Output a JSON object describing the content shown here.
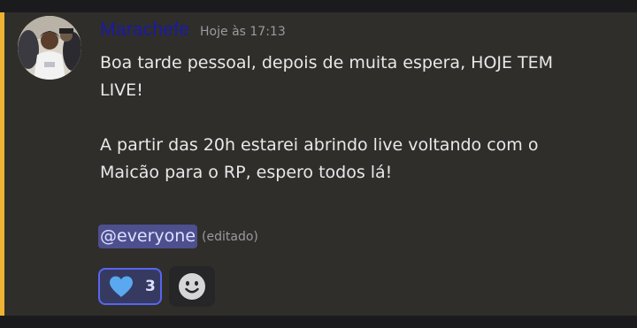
{
  "message": {
    "username": "Marachefe",
    "timestamp": "Hoje às 17:13",
    "lines": [
      "Boa tarde pessoal, depois de muita espera, HOJE TEM LIVE!",
      "A partir das 20h estarei abrindo live voltando com o Maicão para o RP, espero todos lá!"
    ],
    "mention": "@everyone",
    "edited_label": "(editado)"
  },
  "reactions": [
    {
      "icon": "blue-heart-icon",
      "count": "3"
    }
  ],
  "add_reaction_icon": "smiley-icon",
  "colors": {
    "username": "#1a1aa8",
    "highlight_bar": "#f0b232",
    "mention_bg": "#4d4f8f",
    "reaction_border": "#5865f2",
    "heart": "#5aa8f0"
  }
}
